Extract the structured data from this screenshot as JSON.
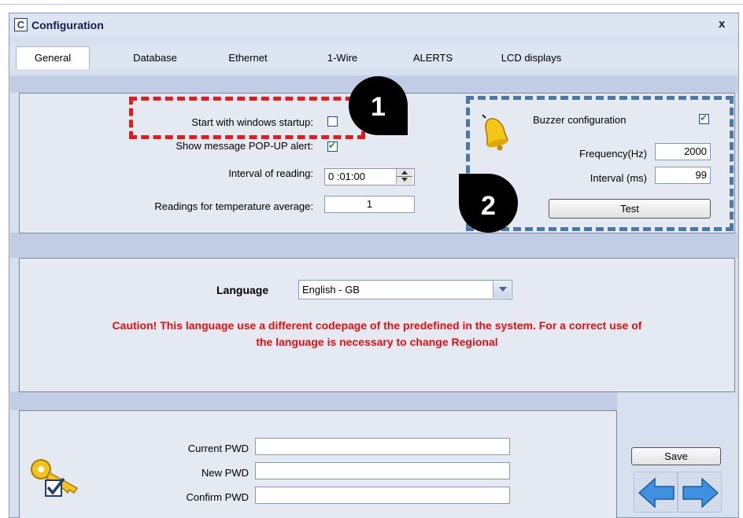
{
  "window": {
    "title": "Configuration",
    "title_icon_letter": "C",
    "close_label": "x"
  },
  "tabs": [
    {
      "label": "General"
    },
    {
      "label": "Database"
    },
    {
      "label": "Ethernet"
    },
    {
      "label": "1-Wire"
    },
    {
      "label": "ALERTS"
    },
    {
      "label": "LCD displays"
    }
  ],
  "general": {
    "start_with_windows_label": "Start with windows startup:",
    "start_with_windows_checked": false,
    "show_popup_label": "Show message POP-UP alert:",
    "show_popup_checked": true,
    "interval_label": "Interval of reading:",
    "interval_value": "0 :01:00",
    "readings_label": "Readings for temperature average:",
    "readings_value": "1"
  },
  "buzzer": {
    "label": "Buzzer configuration",
    "checked": true,
    "frequency_label": "Frequency(Hz)",
    "frequency_value": "2000",
    "interval_label": "Interval (ms)",
    "interval_value": "99",
    "test_label": "Test",
    "icon": "bell-icon"
  },
  "language": {
    "label": "Language",
    "selected": "English - GB",
    "caution_line1": "Caution! This language use a different codepage of the predefined in the system. For a correct use of",
    "caution_line2": "the language is necessary to change Regional"
  },
  "password": {
    "current_label": "Current PWD",
    "new_label": "New PWD",
    "confirm_label": "Confirm PWD",
    "current_value": "",
    "new_value": "",
    "confirm_value": "",
    "icon": "keys-icon"
  },
  "actions": {
    "save_label": "Save",
    "prev_icon": "arrow-left-icon",
    "next_icon": "arrow-right-icon"
  },
  "annotations": {
    "marker1": "1",
    "marker2": "2"
  },
  "colors": {
    "caution": "#e01010",
    "check": "#21a121",
    "annotation1": "#e31b1b",
    "annotation2": "#4a78a8"
  }
}
